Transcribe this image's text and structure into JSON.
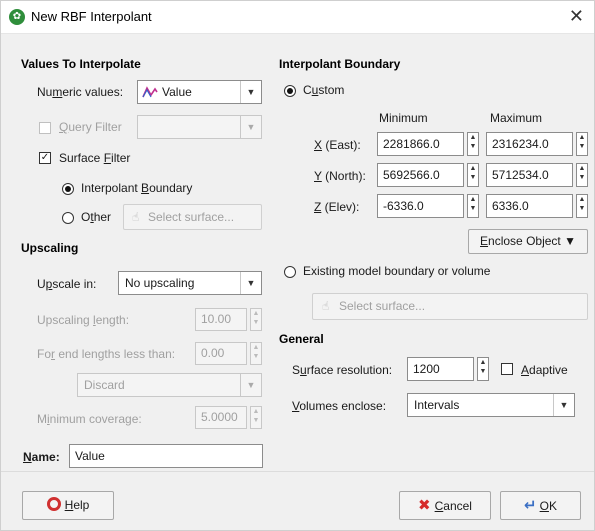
{
  "window": {
    "title": "New RBF Interpolant",
    "close_glyph": "✕"
  },
  "values_to_interpolate": {
    "heading": "Values To Interpolate",
    "numeric_values": {
      "label_pre": "Nu",
      "label_u": "m",
      "label_post": "eric values:",
      "value": "Value"
    },
    "query_filter": {
      "label_u": "Q",
      "label_post": "uery Filter",
      "checked": false,
      "enabled": false
    },
    "surface_filter": {
      "label_pre": "Surface ",
      "label_u": "F",
      "label_post": "ilter",
      "checked": true,
      "options": [
        {
          "label_pre": "Interpolant ",
          "label_u": "B",
          "label_post": "oundary",
          "selected": true
        },
        {
          "label_pre": "O",
          "label_u": "t",
          "label_post": "her",
          "selected": false
        }
      ],
      "select_surface": "Select surface..."
    }
  },
  "upscaling": {
    "heading": "Upscaling",
    "upscale_in": {
      "label_pre": "U",
      "label_u": "p",
      "label_post": "scale in:",
      "value": "No upscaling"
    },
    "upscaling_length": {
      "label_pre": "Upscaling ",
      "label_u": "l",
      "label_post": "ength:",
      "value": "10.00"
    },
    "end_lengths": {
      "label_pre": "Fo",
      "label_u": "r",
      "label_post": " end lengths less than:",
      "value": "0.00"
    },
    "discard": "Discard",
    "minimum_coverage": {
      "label_pre": "M",
      "label_u": "i",
      "label_post": "nimum coverage:",
      "value": "5.0000"
    }
  },
  "name": {
    "label_u": "N",
    "label_post": "ame:",
    "value": "Value"
  },
  "interpolant_boundary": {
    "heading": "Interpolant Boundary",
    "custom": {
      "label_pre": "C",
      "label_u": "u",
      "label_post": "stom",
      "selected": true
    },
    "col_min": "Minimum",
    "col_max": "Maximum",
    "rows": [
      {
        "label_u": "X",
        "label_post": " (East):",
        "min": "2281866.0",
        "max": "2316234.0"
      },
      {
        "label_u": "Y",
        "label_post": " (North):",
        "min": "5692566.0",
        "max": "5712534.0"
      },
      {
        "label_u": "Z",
        "label_post": " (Elev):",
        "min": "-6336.0",
        "max": "6336.0"
      }
    ],
    "enclose_object": {
      "label_u": "E",
      "label_post": "nclose Object ▼"
    },
    "existing_model": {
      "label": "Existing model boundary or volume",
      "selected": false
    },
    "select_surface": "Select surface..."
  },
  "general": {
    "heading": "General",
    "surface_resolution": {
      "label_pre": "S",
      "label_u": "u",
      "label_post": "rface resolution:",
      "value": "1200"
    },
    "adaptive": {
      "label_u": "A",
      "label_post": "daptive",
      "checked": false
    },
    "volumes_enclose": {
      "label_u": "V",
      "label_post": "olumes enclose:",
      "value": "Intervals"
    }
  },
  "buttons": {
    "help": {
      "label_u": "H",
      "label_post": "elp"
    },
    "cancel": {
      "label_u": "C",
      "label_post": "ancel"
    },
    "ok": {
      "label_u": "O",
      "label_post": "K"
    }
  },
  "colors": {
    "accent_green": "#2f8e3b",
    "cancel_red": "#d62b2b",
    "help_red": "#d03030",
    "ok_blue": "#3a6fc4"
  }
}
